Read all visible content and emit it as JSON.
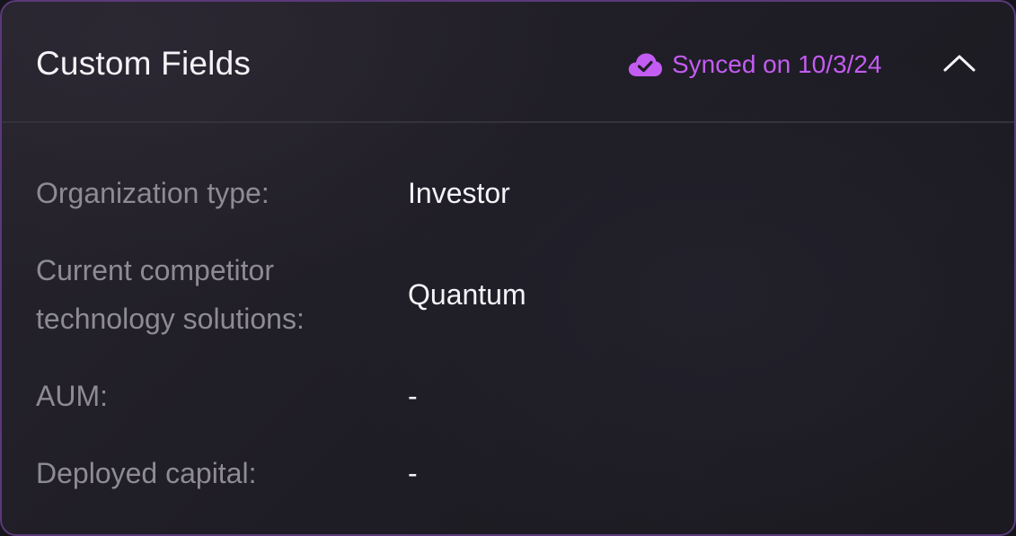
{
  "header": {
    "title": "Custom Fields",
    "sync_status": "Synced on 10/3/24",
    "sync_icon": "cloud-check-icon",
    "collapse_icon": "chevron-up-icon",
    "accent_color": "#c35cf2"
  },
  "fields": [
    {
      "label": "Organization type:",
      "value": "Investor"
    },
    {
      "label_line1": "Current competitor",
      "label_line2": "technology solutions:",
      "value": "Quantum"
    },
    {
      "label": "AUM:",
      "value": "-"
    },
    {
      "label": "Deployed capital:",
      "value": "-"
    }
  ]
}
